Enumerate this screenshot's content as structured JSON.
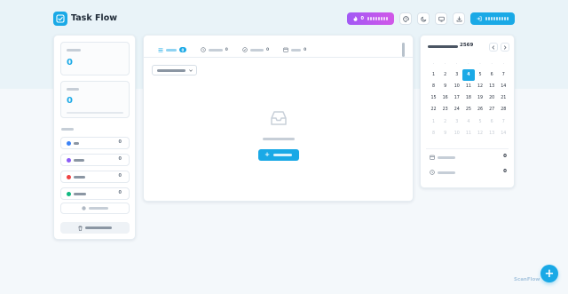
{
  "brand": {
    "title": "Task Flow",
    "accent": "#1aa9e6"
  },
  "header": {
    "premium_count": "0"
  },
  "sidebar": {
    "stat_total": "0",
    "stat_completed": "0",
    "progress_value": 0,
    "categories": [
      {
        "color": "#3b82f6",
        "count": "0"
      },
      {
        "color": "#8b5cf6",
        "count": "0"
      },
      {
        "color": "#ef4444",
        "count": "0"
      },
      {
        "color": "#10b981",
        "count": "0"
      }
    ]
  },
  "tabs": [
    {
      "icon": "list-icon",
      "count": "0",
      "active": true
    },
    {
      "icon": "clock-icon",
      "count": "0",
      "active": false
    },
    {
      "icon": "check-circle-icon",
      "count": "0",
      "active": false
    },
    {
      "icon": "calendar-icon",
      "count": "0",
      "active": false
    }
  ],
  "calendar": {
    "year": "2569",
    "today": "4",
    "rows": [
      [
        "1",
        "2",
        "3",
        "4",
        "5",
        "6",
        "7"
      ],
      [
        "8",
        "9",
        "10",
        "11",
        "12",
        "13",
        "14"
      ],
      [
        "15",
        "16",
        "17",
        "18",
        "19",
        "20",
        "21"
      ],
      [
        "22",
        "23",
        "24",
        "25",
        "26",
        "27",
        "28"
      ],
      [
        "1",
        "2",
        "3",
        "4",
        "5",
        "6",
        "7"
      ],
      [
        "8",
        "9",
        "10",
        "11",
        "12",
        "13",
        "14"
      ]
    ],
    "stat_due": "0",
    "stat_overdue": "0"
  },
  "watermark": "ScanFlow",
  "fab_symbol": "+"
}
